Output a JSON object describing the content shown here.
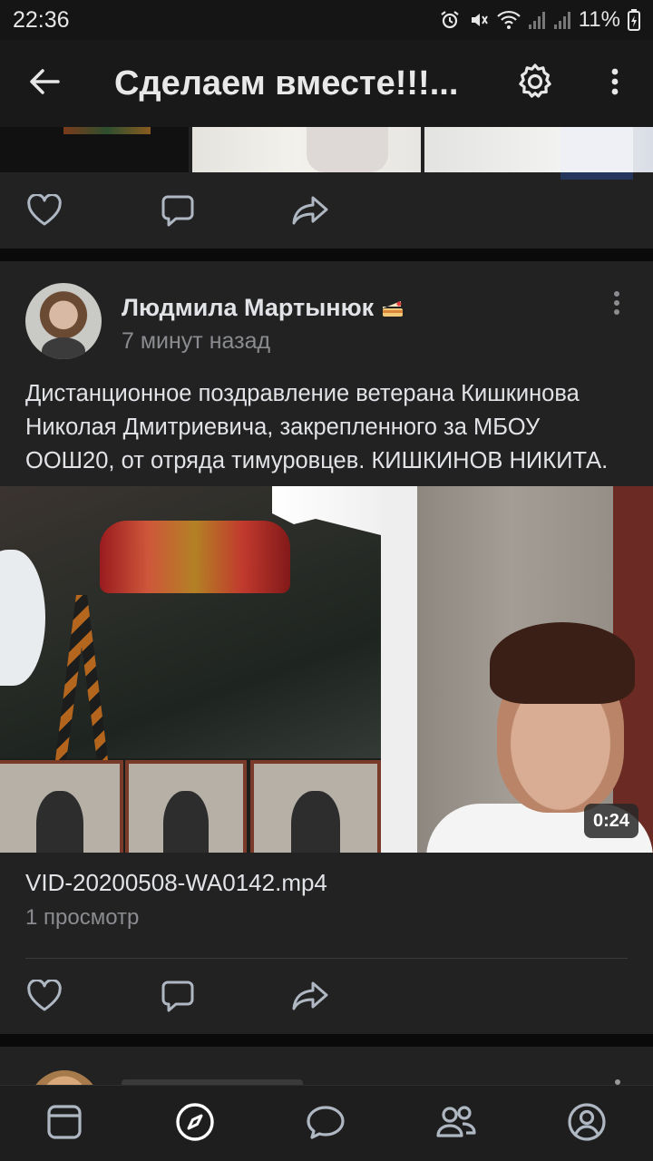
{
  "status_bar": {
    "time": "22:36",
    "battery": "11%",
    "icons": [
      "alarm-icon",
      "mute-icon",
      "wifi-icon",
      "signal-icon",
      "signal-icon",
      "battery-icon"
    ]
  },
  "header": {
    "title": "Сделаем вместе!!!...",
    "icons": [
      "back-arrow-icon",
      "gear-icon",
      "more-vertical-icon"
    ]
  },
  "post": {
    "author": "Людмила Мартынюк",
    "author_badge_icon": "cake-icon",
    "time": "7 минут назад",
    "text": "Дистанционное поздравление ветерана Кишкинова Николая Дмитриевича, закрепленного за МБОУ ООШ20, от отряда тимуровцев. КИШКИНОВ НИКИТА.",
    "video": {
      "duration": "0:24",
      "file_name": "VID-20200508-WA0142.mp4",
      "views": "1 просмотр"
    }
  },
  "actions": [
    "like-icon",
    "comment-icon",
    "share-icon"
  ],
  "tabbar": {
    "items": [
      "news-icon",
      "discover-icon",
      "messages-icon",
      "friends-icon",
      "profile-icon"
    ],
    "active": "discover-icon"
  },
  "colors": {
    "background": "#0a0a0a",
    "card": "#222223",
    "header": "#191919",
    "text": "#e1e3e6",
    "secondary_text": "#8a8c8f",
    "icon": "#aeb7c2"
  }
}
